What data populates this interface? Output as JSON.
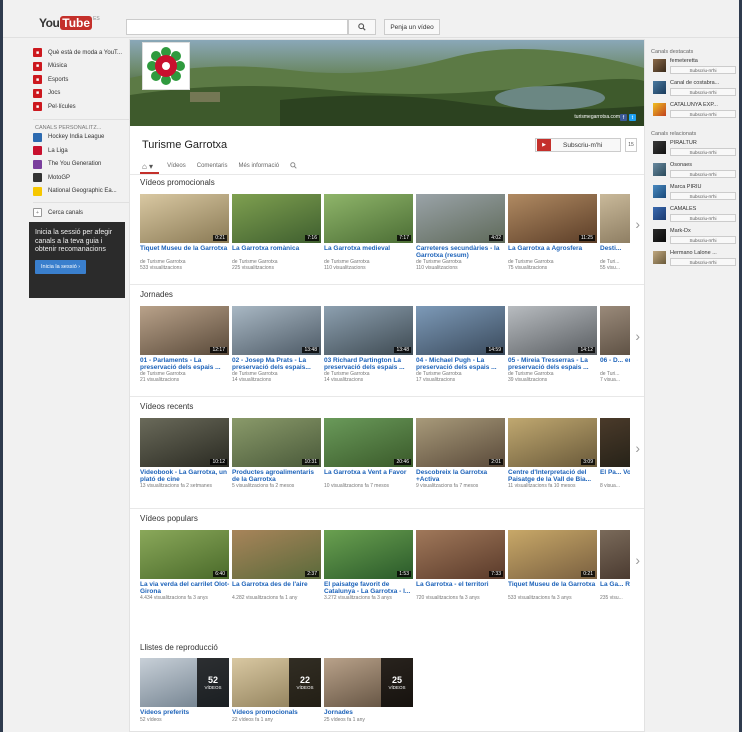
{
  "header": {
    "logo_you": "You",
    "logo_tube": "Tube",
    "logo_region": "ES",
    "search_placeholder": "",
    "search_icon": "search-icon",
    "upload_label": "Penja un vídeo"
  },
  "sidebar": {
    "items": [
      {
        "label": "Què està de moda a YouT...",
        "icon": "trending-icon",
        "color": "#cc181e"
      },
      {
        "label": "Música",
        "icon": "music-icon",
        "color": "#cc181e"
      },
      {
        "label": "Esports",
        "icon": "sports-icon",
        "color": "#cc181e"
      },
      {
        "label": "Jocs",
        "icon": "gaming-icon",
        "color": "#cc181e"
      },
      {
        "label": "Pel·lícules",
        "icon": "movies-icon",
        "color": "#cc181e"
      }
    ],
    "channels_heading": "CANALS PERSONALITZ...",
    "channels": [
      {
        "label": "Hockey India League",
        "color": "#2c6ab0"
      },
      {
        "label": "La Liga",
        "color": "#c8102e"
      },
      {
        "label": "The You Generation",
        "color": "#7a3e9d"
      },
      {
        "label": "MotoGP",
        "color": "#333333"
      },
      {
        "label": "National Geographic Ea...",
        "color": "#f6c700"
      }
    ],
    "browse_label": "Cerca canals",
    "signin_text": "Inicia la sessió per afegir canals a la teva guia i obtenir recomanacions",
    "signin_button": "Inicia la sessió ›"
  },
  "channel": {
    "banner_url": "turismegarrotxa.com",
    "title": "Turisme Garrotxa",
    "subscribe_label": "Subscriu-m'hi",
    "subscriber_count": "15",
    "tabs": [
      "Vídeos",
      "Comentaris",
      "Més informació"
    ],
    "tab_icons": [
      "home-icon",
      "search-icon"
    ]
  },
  "sections": [
    {
      "title": "Vídeos promocionals",
      "videos": [
        {
          "title": "Tiquet Museu de la Garrotxa",
          "channel": "de Turisme Garrotxa",
          "views": "533 visualitzacions",
          "duration": "0:21",
          "colors": [
            "#d9c8a2",
            "#8a7a55"
          ]
        },
        {
          "title": "La Garrotxa romànica",
          "channel": "de Turisme Garrotxa",
          "views": "225 visualitzacions",
          "duration": "7:16",
          "colors": [
            "#7fa050",
            "#3f5f2f"
          ]
        },
        {
          "title": "La Garrotxa medieval",
          "channel": "de Turisme Garrotxa",
          "views": "110 visualitzacions",
          "duration": "7:17",
          "colors": [
            "#8fb56a",
            "#4c6e35"
          ]
        },
        {
          "title": "Carreteres secundàries - la Garrotxa (resum)",
          "channel": "de Turisme Garrotxa",
          "views": "110 visualitzacions",
          "duration": "4:02",
          "colors": [
            "#9aa3a8",
            "#5f6a5a"
          ]
        },
        {
          "title": "La Garrotxa a Agrosfera",
          "channel": "de Turisme Garrotxa",
          "views": "75 visualitzacions",
          "duration": "11:25",
          "colors": [
            "#b08a62",
            "#5c3e28"
          ]
        },
        {
          "title": "Desti...",
          "channel": "de Turi...",
          "views": "55 visu...",
          "duration": "",
          "colors": [
            "#c9b99a",
            "#7a6a50"
          ]
        }
      ]
    },
    {
      "title": "Jornades",
      "videos": [
        {
          "title": "01 - Parlaments - La preservació dels espais ...",
          "channel": "de Turisme Garrotxa",
          "views": "21 visualitzacions",
          "duration": "12:17",
          "colors": [
            "#b9a28a",
            "#5a4a3a"
          ]
        },
        {
          "title": "02 - Josep Ma Prats - La preservació dels espais...",
          "channel": "de Turisme Garrotxa",
          "views": "14 visualitzacions",
          "duration": "13:48",
          "colors": [
            "#a9b8c4",
            "#4d5a66"
          ]
        },
        {
          "title": "03 Richard Partington La preservació dels espais ...",
          "channel": "de Turisme Garrotxa",
          "views": "14 visualitzacions",
          "duration": "13:48",
          "colors": [
            "#8da0b0",
            "#3e4a52"
          ]
        },
        {
          "title": "04 - Michael Pugh - La preservació dels espais ...",
          "channel": "de Turisme Garrotxa",
          "views": "17 visualitzacions",
          "duration": "14:59",
          "colors": [
            "#7d9ab8",
            "#3a4a5c"
          ]
        },
        {
          "title": "05 - Mireia Tresserras - La preservació dels espais ...",
          "channel": "de Turisme Garrotxa",
          "views": "39 visualitzacions",
          "duration": "14:12",
          "colors": [
            "#b8bcc0",
            "#5a5e62"
          ]
        },
        {
          "title": "06 - D... en un...",
          "channel": "de Turi...",
          "views": "7 visua...",
          "duration": "",
          "colors": [
            "#9a8a7a",
            "#4a3e32"
          ]
        }
      ]
    },
    {
      "title": "Vídeos recents",
      "videos": [
        {
          "title": "Videobook - La Garrotxa, un plató de cine",
          "channel": "",
          "views": "13 visualitzacions  fa 2 setmanes",
          "duration": "10:12",
          "colors": [
            "#6a6a5a",
            "#2a2a22"
          ]
        },
        {
          "title": "Productes agroalimentaris de la Garrotxa",
          "channel": "",
          "views": "5 visualitzacions  fa 2 mesos",
          "duration": "10:31",
          "colors": [
            "#8a9a6a",
            "#4a5a3a"
          ]
        },
        {
          "title": "La Garrotxa a Vent a Favor",
          "channel": "",
          "views": "10 visualitzacions  fa 7 mesos",
          "duration": "20:46",
          "colors": [
            "#6a9a5a",
            "#3a5a2a"
          ]
        },
        {
          "title": "Descobreix la Garrotxa +Activa",
          "channel": "",
          "views": "9 visualitzacions  fa 7 mesos",
          "duration": "2:01",
          "colors": [
            "#a89a7a",
            "#5a4a3a"
          ]
        },
        {
          "title": "Centre d'Interpretació del Paisatge de la Vall de Bia...",
          "channel": "",
          "views": "11 visualitzacions  fa 10 mesos",
          "duration": "3:09",
          "colors": [
            "#c0a870",
            "#6a5a3a"
          ]
        },
        {
          "title": "El Pa... Volca...",
          "channel": "",
          "views": "8 visua...",
          "duration": "",
          "colors": [
            "#4a3a2a",
            "#1a1a12"
          ]
        }
      ]
    },
    {
      "title": "Vídeos populars",
      "videos": [
        {
          "title": "La via verda del carrilet Olot-Girona",
          "channel": "",
          "views": "4.434 visualitzacions  fa 3 anys",
          "duration": "6:40",
          "colors": [
            "#8aa85a",
            "#4a6a2a"
          ]
        },
        {
          "title": "La Garrotxa des de l'aire",
          "channel": "",
          "views": "4.282 visualitzacions  fa 1 any",
          "duration": "2:37",
          "colors": [
            "#a8845a",
            "#5a6a3a"
          ]
        },
        {
          "title": "El paisatge favorit de Catalunya - La Garrotxa - l...",
          "channel": "",
          "views": "3.272 visualitzacions  fa 3 anys",
          "duration": "1:53",
          "colors": [
            "#6aa050",
            "#2a5a2a"
          ]
        },
        {
          "title": "La Garrotxa - el territori",
          "channel": "",
          "views": "720 visualitzacions  fa 3 anys",
          "duration": "7:33",
          "colors": [
            "#a0785a",
            "#5a3a2a"
          ]
        },
        {
          "title": "Tiquet Museu de la Garrotxa",
          "channel": "",
          "views": "533 visualitzacions  fa 3 anys",
          "duration": "0:21",
          "colors": [
            "#c8a868",
            "#7a6040"
          ]
        },
        {
          "title": "La Ga... Robre...",
          "channel": "",
          "views": "235 visu...",
          "duration": "",
          "colors": [
            "#7a6a5a",
            "#3a2a22"
          ]
        }
      ]
    }
  ],
  "playlists": {
    "title": "Llistes de reproducció",
    "items": [
      {
        "title": "Vídeos preferits",
        "meta": "52 vídeos",
        "count": "52",
        "count_label": "VÍDEOS",
        "colors": [
          "#c8d0d8",
          "#6a7a88"
        ]
      },
      {
        "title": "Vídeos promocionals",
        "meta": "22 vídeos  fa 1 any",
        "count": "22",
        "count_label": "VÍDEOS",
        "colors": [
          "#d9c8a2",
          "#8a7a55"
        ]
      },
      {
        "title": "Jornades",
        "meta": "25 vídeos  fa 1 any",
        "count": "25",
        "count_label": "VÍDEOS",
        "colors": [
          "#b9a28a",
          "#5a4a3a"
        ]
      }
    ]
  },
  "right_sidebar": {
    "featured_heading": "Canals destacats",
    "featured": [
      {
        "name": "femeteretta",
        "colors": [
          "#8a6a4a",
          "#3a2a1a"
        ]
      },
      {
        "name": "Canal de costabra...",
        "colors": [
          "#4a7aa0",
          "#1a3a5a"
        ]
      },
      {
        "name": "CATALUNYA EXP...",
        "colors": [
          "#f0c020",
          "#c04020"
        ]
      }
    ],
    "related_heading": "Canals relacionats",
    "related": [
      {
        "name": "PIRALTUR",
        "colors": [
          "#3a3a3a",
          "#111111"
        ]
      },
      {
        "name": "Osonaes",
        "colors": [
          "#6a8aa0",
          "#2a4a5a"
        ]
      },
      {
        "name": "Marca PIRIU",
        "colors": [
          "#4a8ac0",
          "#1a4a7a"
        ]
      },
      {
        "name": "CAMALES",
        "colors": [
          "#3a6ab0",
          "#1a3a70"
        ]
      },
      {
        "name": "Mark-Dx",
        "colors": [
          "#2a2a2a",
          "#0a0a0a"
        ]
      },
      {
        "name": "Hermano Lalone ...",
        "colors": [
          "#c0a880",
          "#6a5a3a"
        ]
      }
    ],
    "subscribe_label": "Subscriu-m'hi"
  },
  "colors": {
    "brand_red": "#c4302b",
    "link_blue": "#1c62b9"
  }
}
